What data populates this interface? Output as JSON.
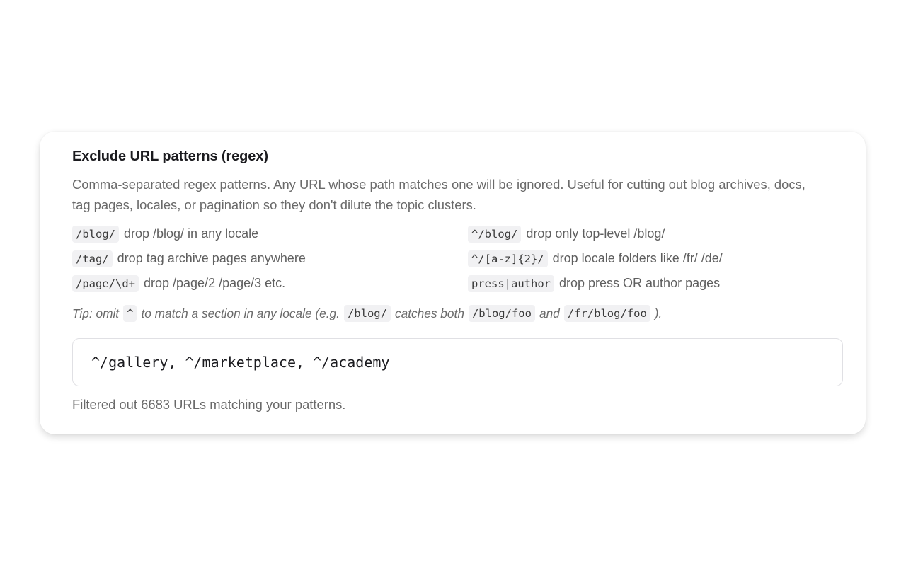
{
  "section": {
    "title": "Exclude URL patterns (regex)",
    "description": "Comma-separated regex patterns. Any URL whose path matches one will be ignored. Useful for cutting out blog archives, docs, tag pages, locales, or pagination so they don't dilute the topic clusters.",
    "examples": [
      {
        "pattern": "/blog/",
        "text": "drop /blog/ in any locale"
      },
      {
        "pattern": "^/blog/",
        "text": "drop only top-level /blog/"
      },
      {
        "pattern": "/tag/",
        "text": "drop tag archive pages anywhere"
      },
      {
        "pattern": "^/[a-z]{2}/",
        "text": "drop locale folders like /fr/ /de/"
      },
      {
        "pattern": "/page/\\d+",
        "text": "drop /page/2 /page/3 etc."
      },
      {
        "pattern": "press|author",
        "text": "drop press OR author pages"
      }
    ],
    "tip": {
      "part1": "Tip: omit",
      "code1": "^",
      "part2": "to match a section in any locale (e.g.",
      "code2": "/blog/",
      "part3": "catches both",
      "code3": "/blog/foo",
      "part4": "and",
      "code4": "/fr/blog/foo",
      "part5": ")."
    },
    "input": {
      "value": "^/gallery, ^/marketplace, ^/academy",
      "placeholder": ""
    },
    "status": "Filtered out 6683 URLs matching your patterns."
  }
}
